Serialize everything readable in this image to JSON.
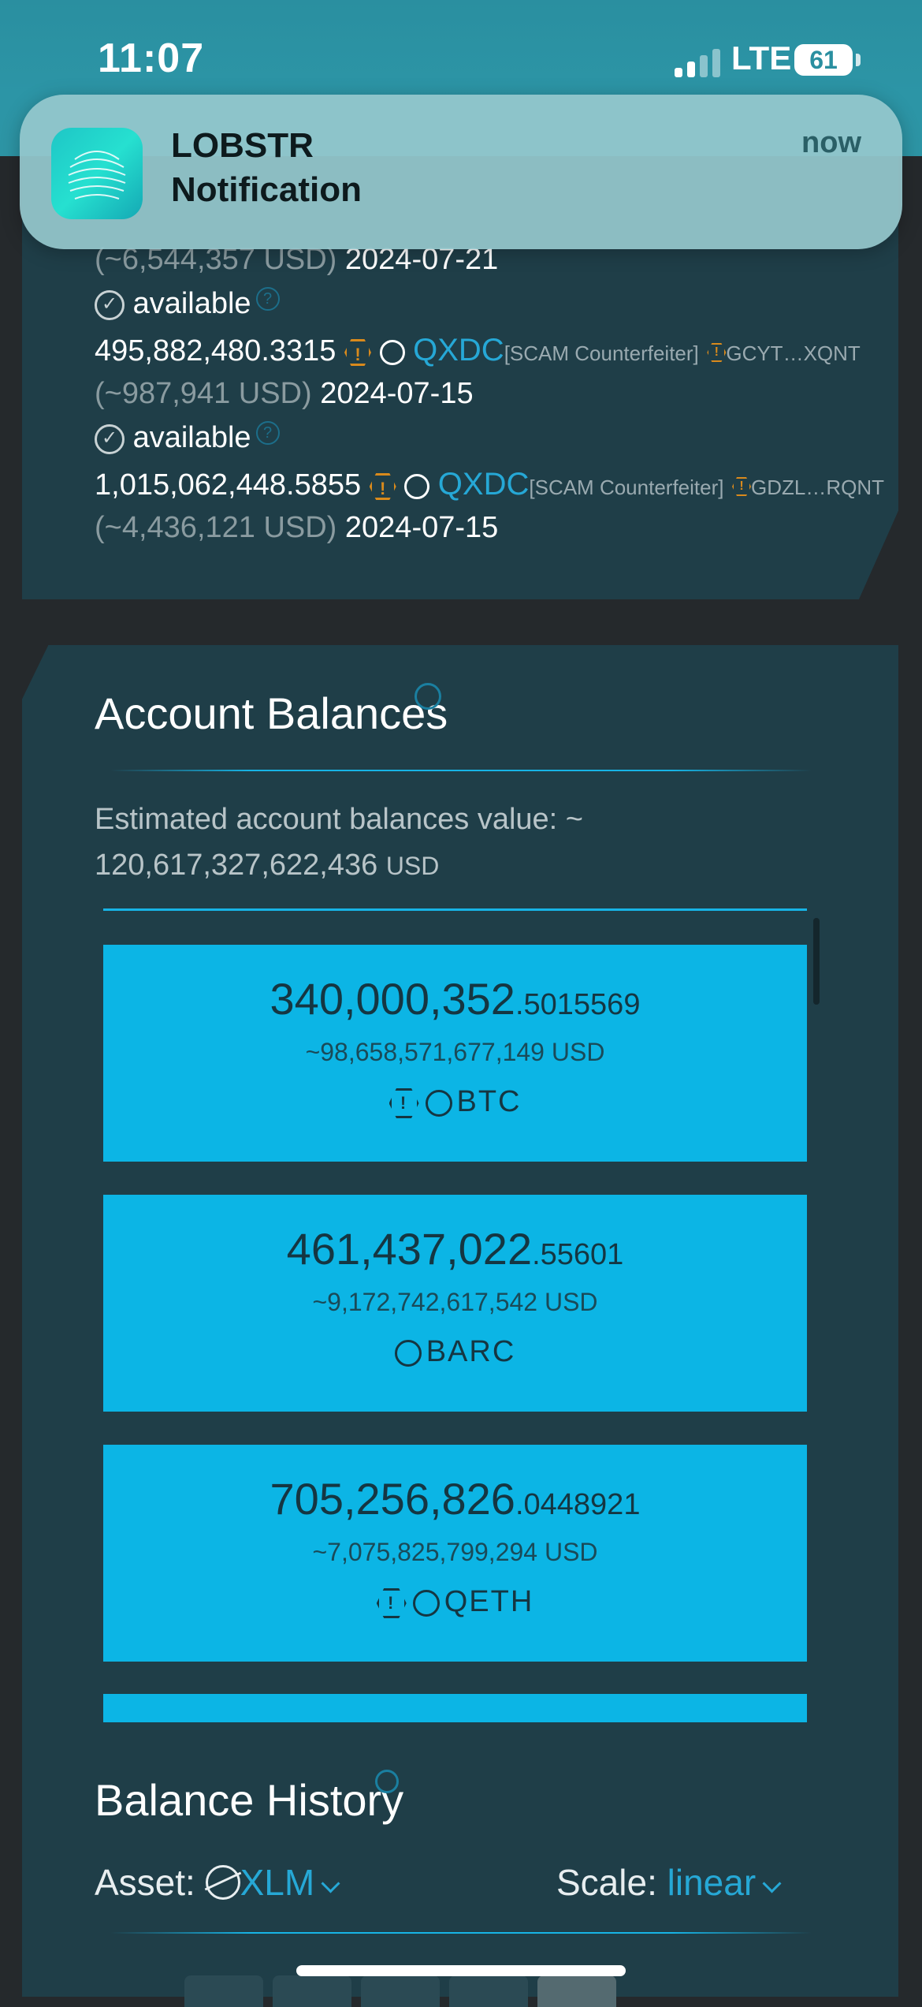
{
  "status_bar": {
    "time": "11:07",
    "network": "LTE",
    "battery": "61"
  },
  "notification": {
    "app": "LOBSTR",
    "message": "Notification",
    "time": "now"
  },
  "offers": [
    {
      "usd": "(~6,544,357 USD)",
      "date": "2024-07-21",
      "status": "available"
    },
    {
      "amount": "495,882,480.3315",
      "asset": "QXDC",
      "tag": "[SCAM Counterfeiter]",
      "issuer": "GCYT…XQNT",
      "usd": "(~987,941 USD)",
      "date": "2024-07-15",
      "status": "available"
    },
    {
      "amount": "1,015,062,448.5855",
      "asset": "QXDC",
      "tag": "[SCAM Counterfeiter]",
      "issuer": "GDZL…RQNT",
      "usd": "(~4,436,121 USD)",
      "date": "2024-07-15"
    }
  ],
  "balances_section": {
    "title": "Account Balances",
    "estimate_label": "Estimated account balances value: ~",
    "estimate_value": "120,617,327,622,436",
    "estimate_unit": "USD"
  },
  "balances": [
    {
      "int": "340,000,352",
      "dec": ".5015569",
      "usd": "~98,658,571,677,149 USD",
      "asset": "BTC",
      "warning": true
    },
    {
      "int": "461,437,022",
      "dec": ".55601",
      "usd": "~9,172,742,617,542 USD",
      "asset": "BARC",
      "warning": false
    },
    {
      "int": "705,256,826",
      "dec": ".0448921",
      "usd": "~7,075,825,799,294 USD",
      "asset": "QETH",
      "warning": true
    }
  ],
  "history_section": {
    "title": "Balance History",
    "asset_label": "Asset:",
    "asset_value": "XLM",
    "scale_label": "Scale:",
    "scale_value": "linear"
  },
  "icons": {
    "warning": "warning-hex-icon",
    "asset": "asset-circle-icon",
    "check": "check-circle-icon",
    "help": "help-icon",
    "eye": "eye-toggle-icon",
    "stellar": "stellar-icon"
  },
  "colors": {
    "accent": "#0cb5e5",
    "link": "#26a8d6",
    "warning": "#d98a1c",
    "card": "#1f3e48"
  }
}
